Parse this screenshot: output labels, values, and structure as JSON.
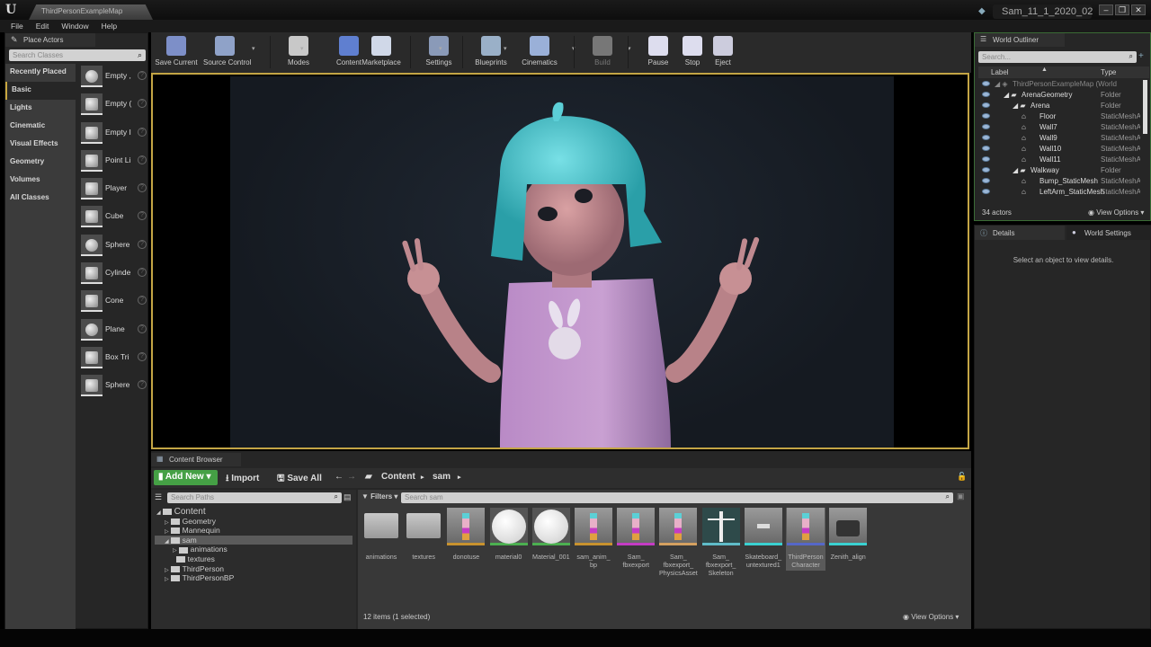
{
  "titlebar": {
    "map_tab": "ThirdPersonExampleMap",
    "project_name": "Sam_11_1_2020_02",
    "window_buttons": [
      "minimize",
      "restore",
      "close"
    ]
  },
  "menu": [
    "File",
    "Edit",
    "Window",
    "Help"
  ],
  "place_actors": {
    "tab_label": "Place Actors",
    "search_placeholder": "Search Classes",
    "categories": [
      "Recently Placed",
      "Basic",
      "Lights",
      "Cinematic",
      "Visual Effects",
      "Geometry",
      "Volumes",
      "All Classes"
    ],
    "selected_category": "Basic",
    "actors": [
      "Empty Actor",
      "Empty Character",
      "Empty Pawn",
      "Point Light",
      "Player Start",
      "Cube",
      "Sphere",
      "Cylinder",
      "Cone",
      "Plane",
      "Box Trigger",
      "Sphere Trigger"
    ],
    "actor_display": [
      "Empty ,",
      "Empty (",
      "Empty I",
      "Point Li",
      "Player",
      "Cube",
      "Sphere",
      "Cylinde",
      "Cone",
      "Plane",
      "Box Tri",
      "Sphere"
    ]
  },
  "toolbar": {
    "buttons": [
      {
        "label": "Save Current",
        "icon": "save-icon"
      },
      {
        "label": "Source Control",
        "icon": "source-control-icon"
      },
      {
        "label": "Modes",
        "icon": "modes-icon"
      },
      {
        "label": "Content",
        "icon": "content-icon"
      },
      {
        "label": "Marketplace",
        "icon": "marketplace-icon"
      },
      {
        "label": "Settings",
        "icon": "settings-icon"
      },
      {
        "label": "Blueprints",
        "icon": "blueprints-icon"
      },
      {
        "label": "Cinematics",
        "icon": "cinematics-icon"
      },
      {
        "label": "Build",
        "icon": "build-icon",
        "disabled": true
      },
      {
        "label": "Pause",
        "icon": "pause-icon"
      },
      {
        "label": "Stop",
        "icon": "stop-icon"
      },
      {
        "label": "Eject",
        "icon": "eject-icon"
      }
    ]
  },
  "world_outliner": {
    "tab_label": "World Outliner",
    "search_placeholder": "Search...",
    "col_label": "Label",
    "col_type": "Type",
    "rows": [
      {
        "label": "ThirdPersonExampleMap (World",
        "type": "",
        "depth": 0,
        "kind": "world"
      },
      {
        "label": "ArenaGeometry",
        "type": "Folder",
        "depth": 1,
        "kind": "folder"
      },
      {
        "label": "Arena",
        "type": "Folder",
        "depth": 2,
        "kind": "folder"
      },
      {
        "label": "Floor",
        "type": "StaticMeshAc",
        "depth": 3,
        "kind": "mesh"
      },
      {
        "label": "Wall7",
        "type": "StaticMeshAc",
        "depth": 3,
        "kind": "mesh"
      },
      {
        "label": "Wall9",
        "type": "StaticMeshAc",
        "depth": 3,
        "kind": "mesh"
      },
      {
        "label": "Wall10",
        "type": "StaticMeshAc",
        "depth": 3,
        "kind": "mesh"
      },
      {
        "label": "Wall11",
        "type": "StaticMeshAc",
        "depth": 3,
        "kind": "mesh"
      },
      {
        "label": "Walkway",
        "type": "Folder",
        "depth": 2,
        "kind": "folder"
      },
      {
        "label": "Bump_StaticMesh",
        "type": "StaticMeshAc",
        "depth": 3,
        "kind": "mesh"
      },
      {
        "label": "LeftArm_StaticMesh",
        "type": "StaticMeshAc",
        "depth": 3,
        "kind": "mesh"
      }
    ],
    "actor_count": "34 actors",
    "view_options": "View Options"
  },
  "details": {
    "tab_details": "Details",
    "tab_world_settings": "World Settings",
    "empty_message": "Select an object to view details."
  },
  "content_browser": {
    "tab_label": "Content Browser",
    "add_new": "Add New",
    "import": "Import",
    "save_all": "Save All",
    "breadcrumb": [
      "Content",
      "sam"
    ],
    "paths_search_placeholder": "Search Paths",
    "filters_label": "Filters",
    "asset_search_placeholder": "Search sam",
    "tree": [
      {
        "label": "Content",
        "depth": 0,
        "expanded": true
      },
      {
        "label": "Geometry",
        "depth": 1
      },
      {
        "label": "Mannequin",
        "depth": 1
      },
      {
        "label": "sam",
        "depth": 1,
        "expanded": true,
        "selected": true
      },
      {
        "label": "animations",
        "depth": 2
      },
      {
        "label": "textures",
        "depth": 2
      },
      {
        "label": "ThirdPerson",
        "depth": 1
      },
      {
        "label": "ThirdPersonBP",
        "depth": 1
      }
    ],
    "assets": [
      {
        "label": "animations",
        "kind": "folder"
      },
      {
        "label": "textures",
        "kind": "folder"
      },
      {
        "label": "donotuse",
        "kind": "character",
        "color": "#c8922e"
      },
      {
        "label": "material0",
        "kind": "material",
        "color": "#4caf50"
      },
      {
        "label": "Material_001",
        "kind": "material",
        "color": "#4caf50"
      },
      {
        "label": "sam_anim_bp",
        "kind": "character",
        "color": "#c8922e"
      },
      {
        "label": "Sam_fbxexport",
        "kind": "character",
        "color": "#c43cc4"
      },
      {
        "label": "Sam_fbxexport_PhysicsAsset",
        "kind": "character",
        "color": "#d4a060"
      },
      {
        "label": "Sam_fbxexport_Skeleton",
        "kind": "skeleton",
        "color": "#5fbcc8"
      },
      {
        "label": "Skateboard_untextured1",
        "kind": "mesh",
        "color": "#3ad0d0"
      },
      {
        "label": "ThirdPerson Character",
        "kind": "character",
        "color": "#5567c8",
        "selected": true
      },
      {
        "label": "Zenith_align",
        "kind": "camera",
        "color": "#3ad0d0"
      }
    ],
    "status": "12 items (1 selected)",
    "view_options": "View Options"
  }
}
